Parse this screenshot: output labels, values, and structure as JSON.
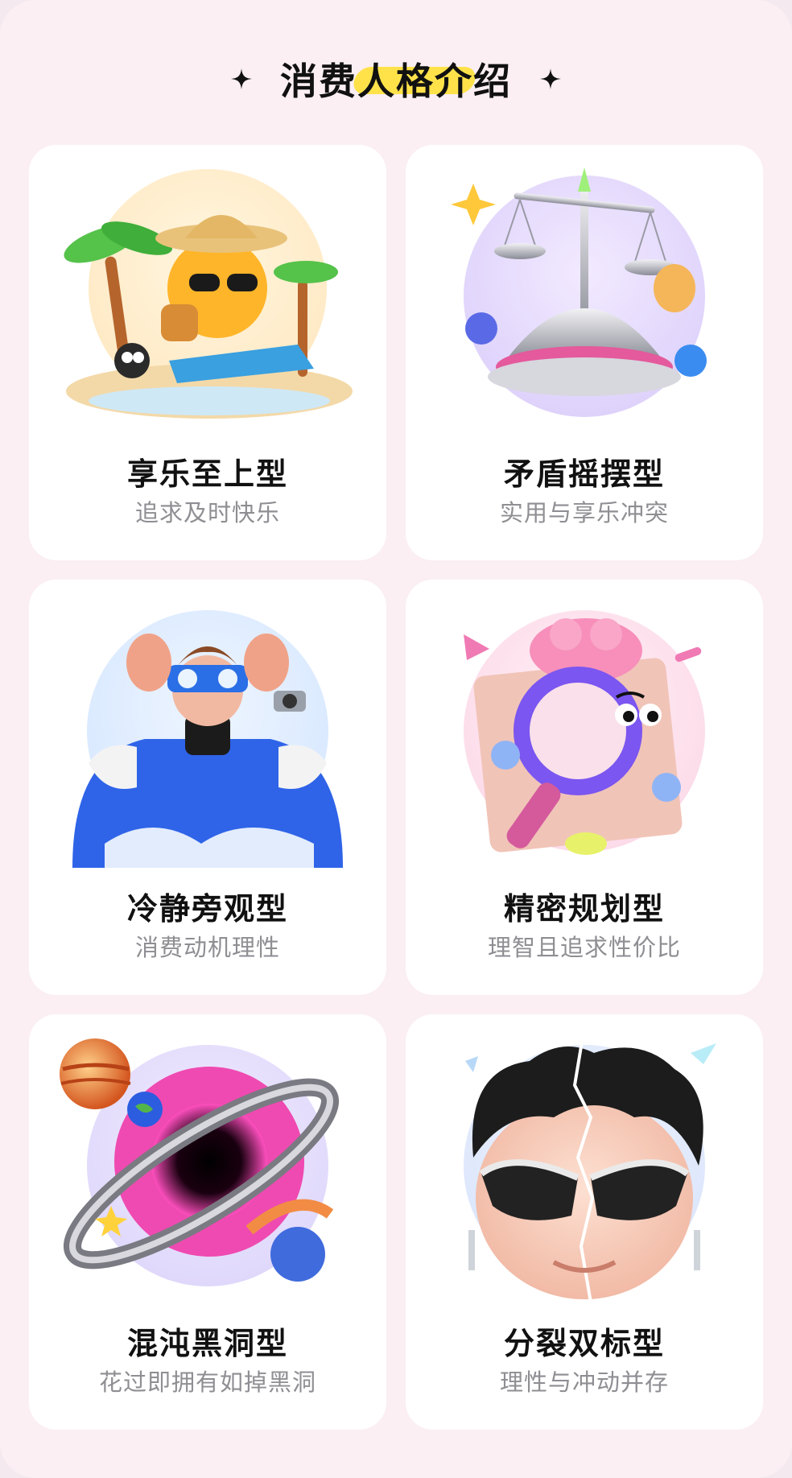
{
  "header": {
    "title": "消费人格介绍"
  },
  "cards": [
    {
      "title": "享乐至上型",
      "subtitle": "追求及时快乐",
      "icon": "beach-sun-character-icon"
    },
    {
      "title": "矛盾摇摆型",
      "subtitle": "实用与享乐冲突",
      "icon": "balance-scale-icon"
    },
    {
      "title": "冷静旁观型",
      "subtitle": "消费动机理性",
      "icon": "observer-character-icon"
    },
    {
      "title": "精密规划型",
      "subtitle": "理智且追求性价比",
      "icon": "magnifier-character-icon"
    },
    {
      "title": "混沌黑洞型",
      "subtitle": "花过即拥有如掉黑洞",
      "icon": "black-hole-planet-icon"
    },
    {
      "title": "分裂双标型",
      "subtitle": "理性与冲动并存",
      "icon": "split-face-character-icon"
    }
  ],
  "colors": {
    "background": "#fbeff3",
    "card": "#ffffff",
    "title_highlight": "#ffe24a",
    "subtitle_text": "#8e8e93"
  }
}
